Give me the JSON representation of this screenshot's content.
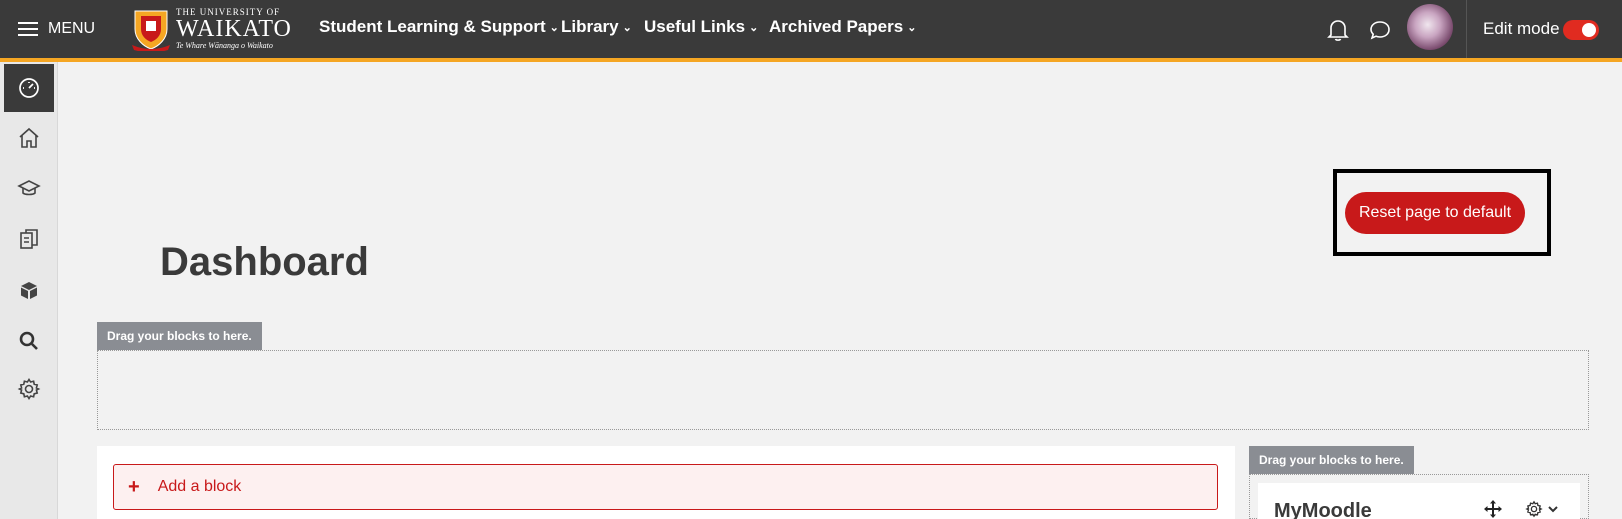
{
  "header": {
    "menu_label": "MENU",
    "logo": {
      "line1": "THE UNIVERSITY OF",
      "line2": "WAIKATO",
      "line3": "Te Whare Wānanga o Waikato"
    },
    "nav": [
      {
        "label": "Student Learning & Support",
        "chevron": "⌄"
      },
      {
        "label": "Library",
        "chevron": "⌄"
      },
      {
        "label": "Useful Links",
        "chevron": "⌄"
      },
      {
        "label": "Archived Papers",
        "chevron": "⌄"
      }
    ],
    "edit_mode_label": "Edit mode",
    "edit_mode_on": true,
    "accent_color": "#f5a623"
  },
  "drawer": {
    "items": [
      {
        "icon": "dashboard-icon",
        "active": true
      },
      {
        "icon": "home-icon",
        "active": false
      },
      {
        "icon": "graduation-cap-icon",
        "active": false
      },
      {
        "icon": "copy-icon",
        "active": false
      },
      {
        "icon": "cube-icon",
        "active": false
      },
      {
        "icon": "search-icon",
        "active": false
      },
      {
        "icon": "gear-icon",
        "active": false
      }
    ]
  },
  "main": {
    "reset_button": "Reset page to default",
    "title": "Dashboard",
    "top_drag_hint": "Drag your blocks to here.",
    "add_block_label": "Add a block",
    "side_drag_hint": "Drag your blocks to here.",
    "side_block_title": "MyMoodle"
  },
  "colors": {
    "navbar": "#3a3a3a",
    "danger": "#c8191a",
    "toggle": "#e02b20"
  }
}
